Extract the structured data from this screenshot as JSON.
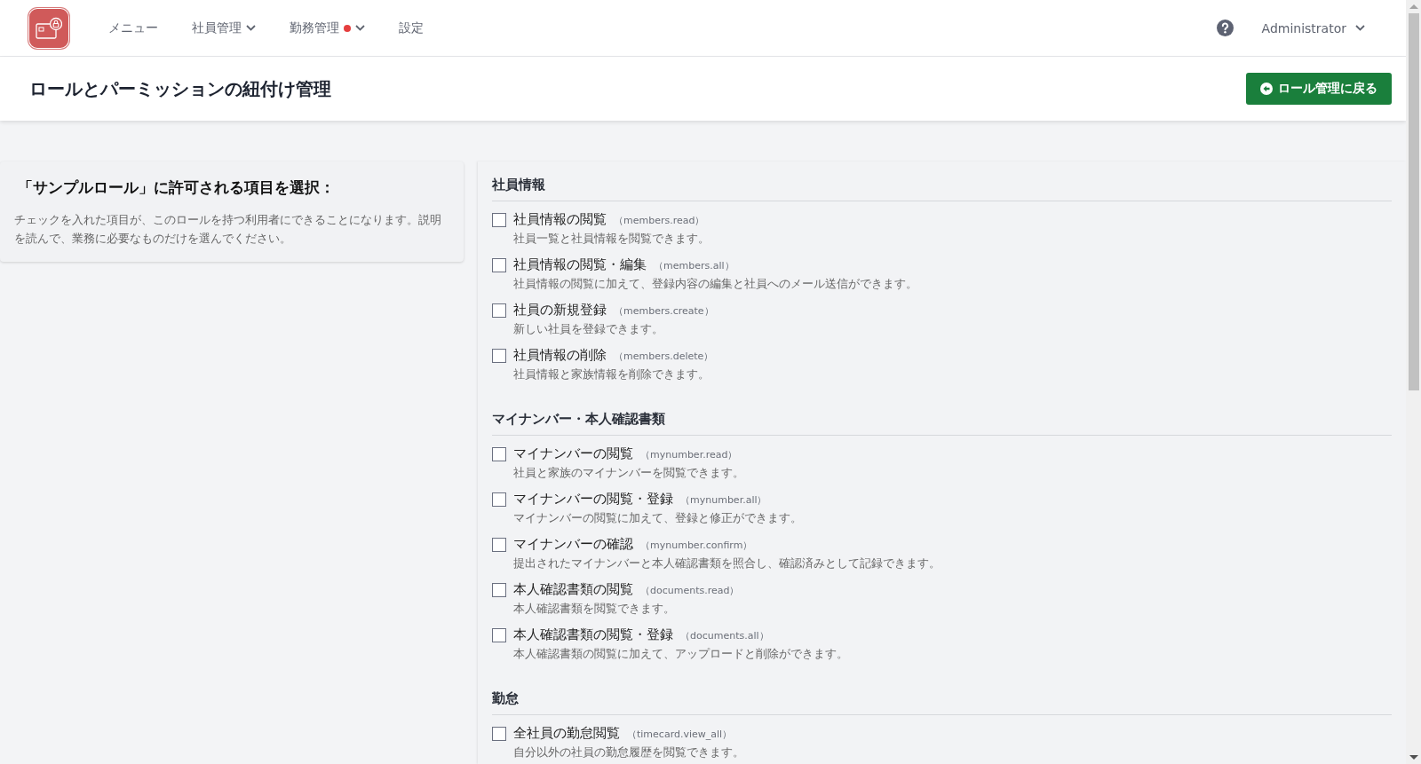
{
  "nav": {
    "menu_items": [
      {
        "label": "メニュー",
        "dropdown": false,
        "notice": false
      },
      {
        "label": "社員管理",
        "dropdown": true,
        "notice": false
      },
      {
        "label": "勤務管理",
        "dropdown": true,
        "notice": true
      },
      {
        "label": "設定",
        "dropdown": false,
        "notice": false
      }
    ],
    "user": "Administrator"
  },
  "page": {
    "title": "ロールとパーミッションの紐付け管理",
    "back_button": "ロール管理に戻る"
  },
  "intro": {
    "heading": "「サンプルロール」に許可される項目を選択：",
    "text": "チェックを入れた項目が、このロールを持つ利用者にできることになります。説明を読んで、業務に必要なものだけを選んでください。"
  },
  "sections": [
    {
      "title": "社員情報",
      "permissions": [
        {
          "label": "社員情報の閲覧",
          "code": "（members.read）",
          "description": "社員一覧と社員情報を閲覧できます。",
          "checked": false
        },
        {
          "label": "社員情報の閲覧・編集",
          "code": "（members.all）",
          "description": "社員情報の閲覧に加えて、登録内容の編集と社員へのメール送信ができます。",
          "checked": false
        },
        {
          "label": "社員の新規登録",
          "code": "（members.create）",
          "description": "新しい社員を登録できます。",
          "checked": false
        },
        {
          "label": "社員情報の削除",
          "code": "（members.delete）",
          "description": "社員情報と家族情報を削除できます。",
          "checked": false
        }
      ]
    },
    {
      "title": "マイナンバー・本人確認書類",
      "permissions": [
        {
          "label": "マイナンバーの閲覧",
          "code": "（mynumber.read）",
          "description": "社員と家族のマイナンバーを閲覧できます。",
          "checked": false
        },
        {
          "label": "マイナンバーの閲覧・登録",
          "code": "（mynumber.all）",
          "description": "マイナンバーの閲覧に加えて、登録と修正ができます。",
          "checked": false
        },
        {
          "label": "マイナンバーの確認",
          "code": "（mynumber.confirm）",
          "description": "提出されたマイナンバーと本人確認書類を照合し、確認済みとして記録できます。",
          "checked": false
        },
        {
          "label": "本人確認書類の閲覧",
          "code": "（documents.read）",
          "description": "本人確認書類を閲覧できます。",
          "checked": false
        },
        {
          "label": "本人確認書類の閲覧・登録",
          "code": "（documents.all）",
          "description": "本人確認書類の閲覧に加えて、アップロードと削除ができます。",
          "checked": false
        }
      ]
    },
    {
      "title": "勤怠",
      "permissions": [
        {
          "label": "全社員の勤怠閲覧",
          "code": "（timecard.view_all）",
          "description": "自分以外の社員の勤怠履歴を閲覧できます。",
          "checked": false
        }
      ]
    }
  ]
}
